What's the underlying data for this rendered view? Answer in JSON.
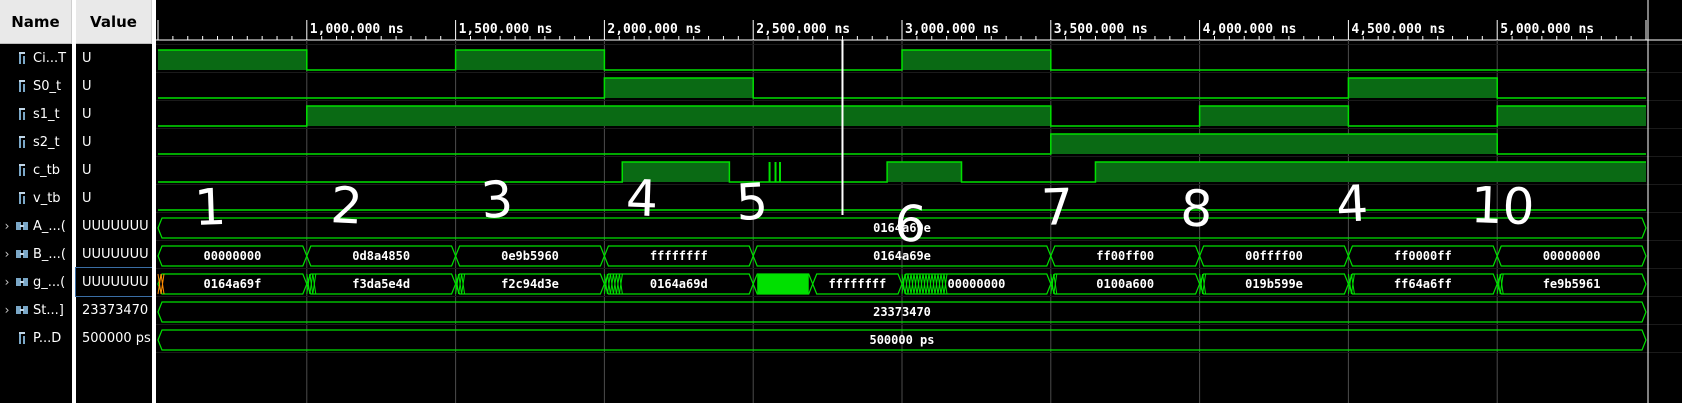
{
  "columns": {
    "name": "Name",
    "value": "Value"
  },
  "signals": [
    {
      "name": "Ci...T",
      "value": "U",
      "kind": "bit"
    },
    {
      "name": "S0_t",
      "value": "U",
      "kind": "bit"
    },
    {
      "name": "s1_t",
      "value": "U",
      "kind": "bit"
    },
    {
      "name": "s2_t",
      "value": "U",
      "kind": "bit"
    },
    {
      "name": "c_tb",
      "value": "U",
      "kind": "bit"
    },
    {
      "name": "v_tb",
      "value": "U",
      "kind": "bit"
    },
    {
      "name": "A_...(",
      "value": "UUUUUUU",
      "kind": "bus"
    },
    {
      "name": "B_...(",
      "value": "UUUUUUU",
      "kind": "bus"
    },
    {
      "name": "g_...(",
      "value": "UUUUUUU",
      "kind": "bus"
    },
    {
      "name": "St...]",
      "value": "23373470",
      "kind": "bus"
    },
    {
      "name": "P...D",
      "value": "500000 ps",
      "kind": "bit"
    }
  ],
  "timeline": {
    "ticks": [
      "1,000.000 ns",
      "1,500.000 ns",
      "2,000.000 ns",
      "2,500.000 ns",
      "3,000.000 ns",
      "3,500.000 ns",
      "4,000.000 ns",
      "4,500.000 ns",
      "5,000.000 ns"
    ],
    "tick_times": [
      1000,
      1500,
      2000,
      2500,
      3000,
      3500,
      4000,
      4500,
      5000
    ],
    "cursor_time": 2800
  },
  "annotations": [
    "1",
    "2",
    "3",
    "4",
    "5",
    "6",
    "7",
    "8",
    "4",
    "10"
  ],
  "bit_waves": {
    "ci_t": [
      [
        500,
        1000,
        1
      ],
      [
        1000,
        1500,
        0
      ],
      [
        1500,
        2000,
        1
      ],
      [
        2000,
        3000,
        0
      ],
      [
        3000,
        3500,
        1
      ],
      [
        3500,
        5500,
        0
      ]
    ],
    "s0_t": [
      [
        500,
        2000,
        0
      ],
      [
        2000,
        2500,
        1
      ],
      [
        2500,
        4500,
        0
      ],
      [
        4500,
        5000,
        1
      ],
      [
        5000,
        5500,
        0
      ]
    ],
    "s1_t": [
      [
        500,
        1000,
        0
      ],
      [
        1000,
        3500,
        1
      ],
      [
        3500,
        4000,
        0
      ],
      [
        4000,
        4500,
        1
      ],
      [
        4500,
        5000,
        0
      ],
      [
        5000,
        5500,
        1
      ]
    ],
    "s2_t": [
      [
        500,
        3500,
        0
      ],
      [
        3500,
        5000,
        1
      ],
      [
        5000,
        5500,
        0
      ]
    ],
    "c_tb": [
      [
        500,
        2060,
        0
      ],
      [
        2060,
        2420,
        1
      ],
      [
        2420,
        2500,
        0
      ],
      [
        2500,
        2700,
        0
      ],
      [
        2700,
        2950,
        0
      ],
      [
        2950,
        3200,
        1
      ],
      [
        3200,
        3650,
        0
      ],
      [
        3650,
        5500,
        1
      ]
    ],
    "v_tb": [
      [
        500,
        5500,
        0
      ]
    ]
  },
  "bus_waves": {
    "a": [
      {
        "from": 500,
        "to": 5500,
        "label": "0164a69e"
      }
    ],
    "b": [
      {
        "from": 500,
        "to": 1000,
        "label": "00000000"
      },
      {
        "from": 1000,
        "to": 1500,
        "label": "0d8a4850"
      },
      {
        "from": 1500,
        "to": 2000,
        "label": "0e9b5960"
      },
      {
        "from": 2000,
        "to": 2500,
        "label": "ffffffff"
      },
      {
        "from": 2500,
        "to": 3500,
        "label": "0164a69e"
      },
      {
        "from": 3500,
        "to": 4000,
        "label": "ff00ff00"
      },
      {
        "from": 4000,
        "to": 4500,
        "label": "00ffff00"
      },
      {
        "from": 4500,
        "to": 5000,
        "label": "ff0000ff"
      },
      {
        "from": 5000,
        "to": 5500,
        "label": "00000000"
      }
    ],
    "g": [
      {
        "from": 500,
        "to": 1000,
        "label": "0164a69f"
      },
      {
        "from": 1000,
        "to": 1500,
        "label": "f3da5e4d"
      },
      {
        "from": 1500,
        "to": 2000,
        "label": "f2c94d3e"
      },
      {
        "from": 2000,
        "to": 2500,
        "label": "0164a69d"
      },
      {
        "from": 2500,
        "to": 2700,
        "label": ""
      },
      {
        "from": 2700,
        "to": 3000,
        "label": "ffffffff"
      },
      {
        "from": 3000,
        "to": 3500,
        "label": "00000000"
      },
      {
        "from": 3500,
        "to": 4000,
        "label": "0100a600"
      },
      {
        "from": 4000,
        "to": 4500,
        "label": "019b599e"
      },
      {
        "from": 4500,
        "to": 5000,
        "label": "ff64a6ff"
      },
      {
        "from": 5000,
        "to": 5500,
        "label": "fe9b5961"
      }
    ],
    "st": [
      {
        "from": 500,
        "to": 5500,
        "label": "23373470"
      }
    ],
    "p": [
      {
        "from": 500,
        "to": 5500,
        "label": "500000 ps"
      }
    ]
  },
  "colors": {
    "wave": "#00e000",
    "fill": "#0a6a14",
    "grid": "#4c4c4c",
    "axis": "#ffffff",
    "glitch": "#ff8c00",
    "bg": "#000000"
  }
}
